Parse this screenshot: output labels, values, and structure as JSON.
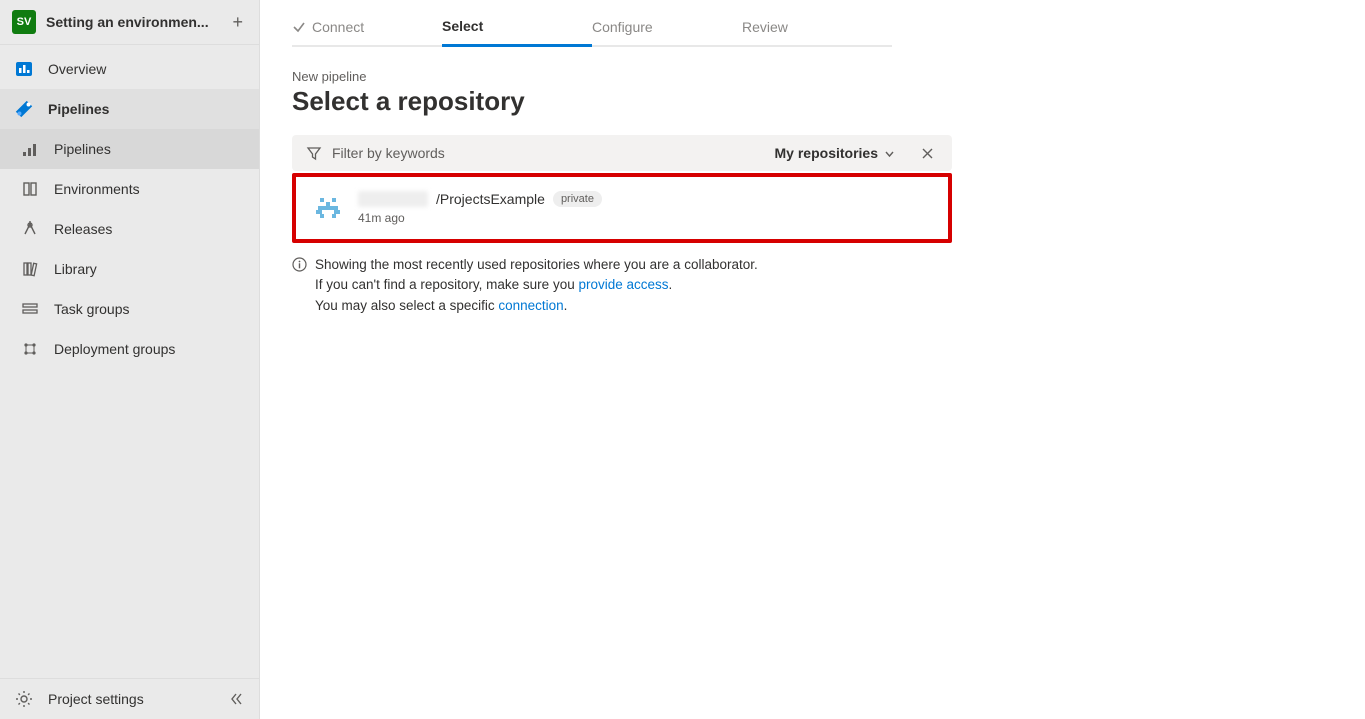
{
  "project": {
    "avatar": "SV",
    "title": "Setting an environmen..."
  },
  "nav": {
    "overview": "Overview",
    "pipelines": "Pipelines",
    "sub": {
      "pipelines": "Pipelines",
      "environments": "Environments",
      "releases": "Releases",
      "library": "Library",
      "task_groups": "Task groups",
      "deployment_groups": "Deployment groups"
    }
  },
  "footer": {
    "settings": "Project settings"
  },
  "steps": {
    "connect": "Connect",
    "select": "Select",
    "configure": "Configure",
    "review": "Review"
  },
  "breadcrumb": "New pipeline",
  "page_title": "Select a repository",
  "filter": {
    "placeholder": "Filter by keywords",
    "scope": "My repositories"
  },
  "repo": {
    "name": "/ProjectsExample",
    "badge": "private",
    "time": "41m ago"
  },
  "info": {
    "line1": "Showing the most recently used repositories where you are a collaborator.",
    "line2a": "If you can't find a repository, make sure you ",
    "line2link": "provide access",
    "line2b": ".",
    "line3a": "You may also select a specific ",
    "line3link": "connection",
    "line3b": "."
  }
}
